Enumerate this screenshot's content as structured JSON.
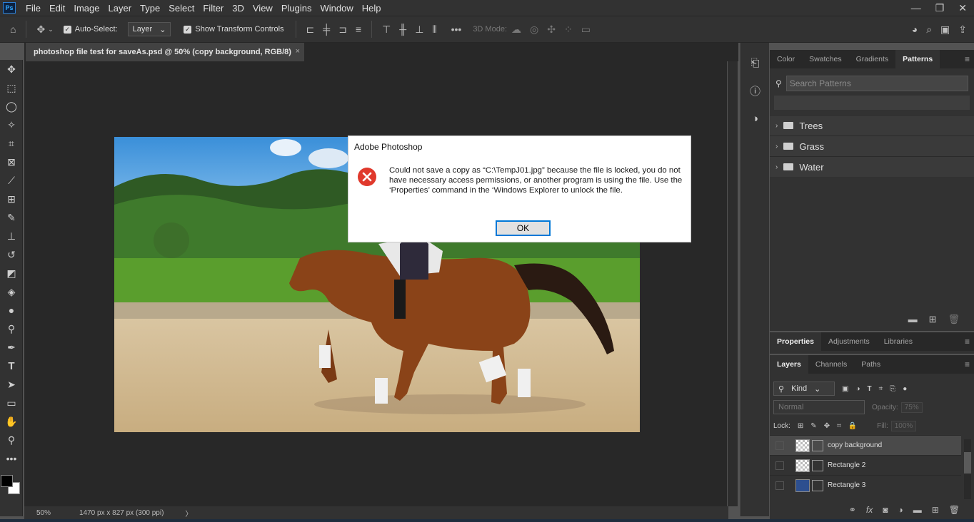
{
  "app": {
    "logo": "Ps"
  },
  "menu": [
    "File",
    "Edit",
    "Image",
    "Layer",
    "Type",
    "Select",
    "Filter",
    "3D",
    "View",
    "Plugins",
    "Window",
    "Help"
  ],
  "window_controls": {
    "minimize": "—",
    "restore": "❐",
    "close": "✕"
  },
  "options_bar": {
    "auto_select_label": "Auto-Select:",
    "layer_dropdown": "Layer",
    "show_transform_label": "Show Transform Controls",
    "mode_3d_label": "3D Mode:"
  },
  "document_tab": {
    "title": "photoshop file test for saveAs.psd @ 50% (copy background, RGB/8)",
    "close": "×"
  },
  "status": {
    "zoom": "50%",
    "dimensions": "1470 px x 827 px (300 ppi)",
    "arrow": "〉"
  },
  "dialog": {
    "title": "Adobe Photoshop",
    "message": "Could not save a copy as “C:\\TempJ01.jpg” because the file is locked, you do not have necessary access permissions, or another program is using the file. Use the ‘Properties’ command in the ‘Windows Explorer to unlock the file.",
    "ok_label": "OK"
  },
  "patterns_panel": {
    "tabs": [
      "Color",
      "Swatches",
      "Gradients",
      "Patterns"
    ],
    "active_tab": "Patterns",
    "search_placeholder": "Search Patterns",
    "folders": [
      "Trees",
      "Grass",
      "Water"
    ]
  },
  "properties_panel": {
    "tabs": [
      "Properties",
      "Adjustments",
      "Libraries"
    ]
  },
  "layers_panel": {
    "tabs": [
      "Layers",
      "Channels",
      "Paths"
    ],
    "kind_label": "Kind",
    "blend_mode": "Normal",
    "opacity_label": "Opacity:",
    "opacity_value": "75%",
    "lock_label": "Lock:",
    "fill_label": "Fill:",
    "fill_value": "100%",
    "layers": [
      "copy background",
      "Rectangle 2",
      "Rectangle 3"
    ]
  },
  "colors": {
    "dialog_error": "#e0392c",
    "ok_border": "#0078d7"
  }
}
